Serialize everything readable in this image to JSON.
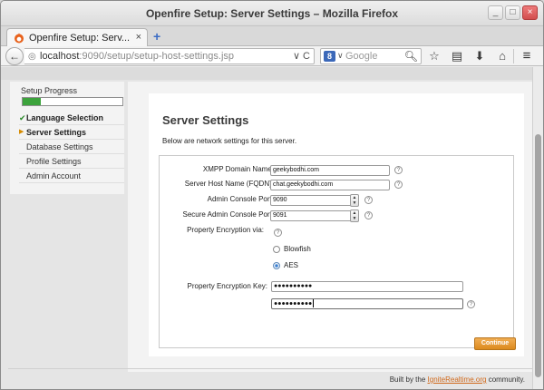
{
  "window": {
    "title": "Openfire Setup: Server Settings – Mozilla Firefox",
    "buttons": {
      "minimize": "_",
      "maximize": "□",
      "close": "×"
    }
  },
  "tab": {
    "title": "Openfire Setup: Serv...",
    "close": "×",
    "new_tab": "+"
  },
  "navbar": {
    "url_host": "localhost",
    "url_rest": ":9090/setup/setup-host-settings.jsp",
    "url_tools": "∨ C",
    "search_engine": "8",
    "search_placeholder": "Google"
  },
  "sidebar": {
    "progress_label": "Setup Progress",
    "progress_fraction": 0.18,
    "steps": [
      {
        "label": "Language Selection",
        "state": "done",
        "mark": "✔"
      },
      {
        "label": "Server Settings",
        "state": "current",
        "mark": "▶"
      },
      {
        "label": "Database Settings",
        "state": "pending",
        "mark": ""
      },
      {
        "label": "Profile Settings",
        "state": "pending",
        "mark": ""
      },
      {
        "label": "Admin Account",
        "state": "pending",
        "mark": ""
      }
    ]
  },
  "main": {
    "heading": "Server Settings",
    "description": "Below are network settings for this server.",
    "fields": {
      "xmpp_domain": {
        "label": "XMPP Domain Name:",
        "value": "geekybodhi.com"
      },
      "fqdn": {
        "label": "Server Host Name (FQDN):",
        "value": "chat.geekybodhi.com"
      },
      "admin_port": {
        "label": "Admin Console Port:",
        "value": "9090"
      },
      "secure_admin_port": {
        "label": "Secure Admin Console Port:",
        "value": "9091"
      },
      "encryption_via": {
        "label": "Property Encryption via:",
        "options": [
          "Blowfish",
          "AES"
        ],
        "selected": "AES"
      },
      "encryption_key": {
        "label": "Property Encryption Key:",
        "value_masked": "●●●●●●●●●●",
        "confirm_masked": "●●●●●●●●●●"
      }
    },
    "help_glyph": "?",
    "continue_label": "Continue"
  },
  "footer": {
    "prefix": "Built by the",
    "link": "IgniteRealtime.org",
    "suffix": "community."
  },
  "colors": {
    "accent_orange": "#dc8a1e",
    "progress_green": "#3ca33c",
    "link_orange": "#d0691b"
  }
}
